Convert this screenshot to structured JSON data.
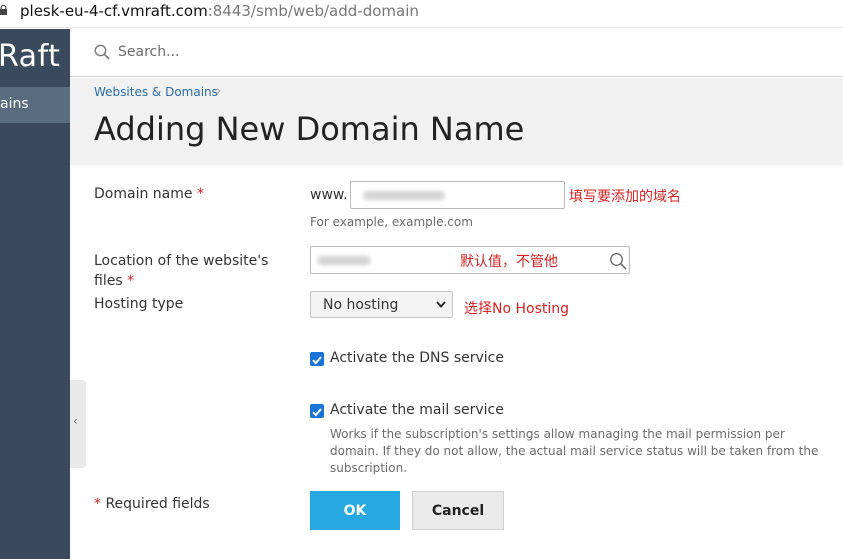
{
  "browser": {
    "url_host": "plesk-eu-4-cf.vmraft.com",
    "url_path": ":8443/smb/web/add-domain"
  },
  "sidebar": {
    "brand": "Raft",
    "active_item": "ains"
  },
  "topbar": {
    "search_placeholder": "Search..."
  },
  "header": {
    "breadcrumb": "Websites & Domains",
    "title": "Adding New Domain Name"
  },
  "form": {
    "domain_label": "Domain name",
    "required_mark": "*",
    "www_prefix": "www.",
    "domain_note": "填写要添加的域名",
    "domain_hint": "For example, example.com",
    "location_label": "Location of the website's files",
    "location_note": "默认值，不管他",
    "hosting_label": "Hosting type",
    "hosting_selected": "No hosting",
    "hosting_note": "选择No Hosting",
    "dns_label": "Activate the DNS service",
    "dns_checked": true,
    "mail_label": "Activate the mail service",
    "mail_checked": true,
    "mail_desc": "Works if the subscription's settings allow managing the mail permission per domain. If they do not allow, the actual mail service status will be taken from the subscription.",
    "required_fields": "Required fields"
  },
  "buttons": {
    "ok": "OK",
    "cancel": "Cancel"
  },
  "colors": {
    "sidebar": "#3a4a5c",
    "primary_button": "#28a8e0",
    "link": "#2a6ea6",
    "annotation": "#d02424",
    "checkbox": "#1a73d9"
  }
}
